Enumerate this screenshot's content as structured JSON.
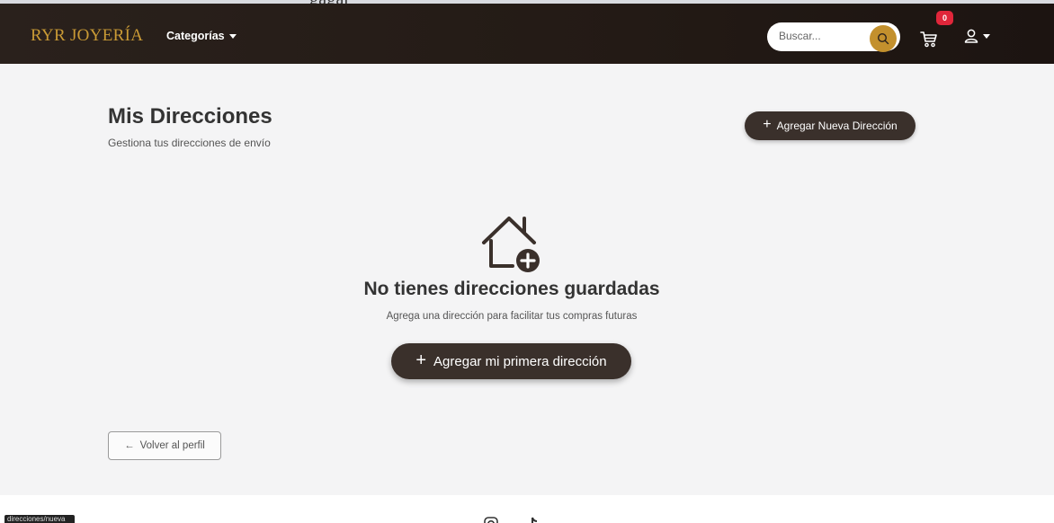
{
  "top_overlay_text": "gagar",
  "navbar": {
    "brand": "RYR JOYERÍA",
    "categories_label": "Categorías",
    "search_placeholder": "Buscar...",
    "cart_count": "0",
    "icons": [
      "search-icon",
      "cart-icon",
      "user-icon",
      "chevron-down-icon"
    ]
  },
  "page": {
    "title": "Mis Direcciones",
    "subtitle": "Gestiona tus direcciones de envío",
    "add_new_label": "Agregar Nueva Dirección"
  },
  "empty_state": {
    "icon": "home-plus-icon",
    "title": "No tienes direcciones guardadas",
    "subtitle": "Agrega una dirección para facilitar tus compras futuras",
    "button_label": "Agregar mi primera dirección"
  },
  "back_button": {
    "label": "Volver al perfil",
    "icon": "arrow-left-icon"
  },
  "footer": {
    "tooltip": "direcciones/nueva",
    "icons": [
      "instagram-icon",
      "tiktok-icon"
    ]
  },
  "colors": {
    "navbar_bg": "#231a15",
    "brand_gold": "#c99a35",
    "search_button": "#c3902d",
    "primary_button": "#3a302b",
    "badge": "#e0263a",
    "page_bg": "#f4f4f5"
  }
}
